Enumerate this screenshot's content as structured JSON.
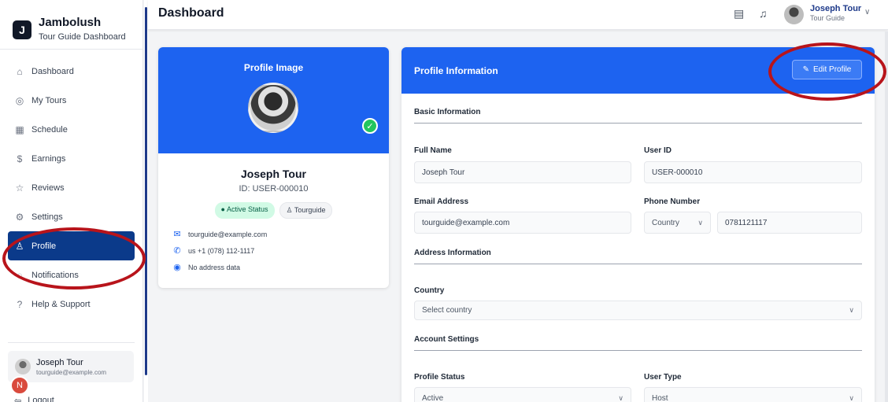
{
  "brand": {
    "name": "Jambolush",
    "subtitle": "Tour Guide Dashboard",
    "logo_glyph": "J"
  },
  "sidebar": {
    "items": [
      {
        "label": "Dashboard",
        "icon": "dashboard-icon",
        "glyph": "⌂"
      },
      {
        "label": "My Tours",
        "icon": "compass-icon",
        "glyph": "◎"
      },
      {
        "label": "Schedule",
        "icon": "calendar-icon",
        "glyph": "▦"
      },
      {
        "label": "Earnings",
        "icon": "earnings-icon",
        "glyph": "$"
      },
      {
        "label": "Reviews",
        "icon": "star-icon",
        "glyph": "☆"
      },
      {
        "label": "Settings",
        "icon": "gear-icon",
        "glyph": "⚙"
      },
      {
        "label": "Profile",
        "icon": "user-icon",
        "glyph": "♙",
        "active": true
      },
      {
        "label": "Notifications",
        "icon": "bell-icon",
        "glyph": "◌"
      },
      {
        "label": "Help & Support",
        "icon": "help-icon",
        "glyph": "?"
      }
    ],
    "user": {
      "name": "Joseph Tour",
      "email": "tourguide@example.com"
    },
    "badge_letter": "N",
    "logout_label": "Logout"
  },
  "header": {
    "title": "Dashboard",
    "user_name": "Joseph Tour",
    "user_role": "Tour Guide"
  },
  "profile_card": {
    "title": "Profile Image",
    "name": "Joseph Tour",
    "id_text": "ID: USER-000010",
    "status_badge": "● Active Status",
    "role_badge": "♙ Tourguide",
    "email": "tourguide@example.com",
    "phone": "us +1 (078) 112-1117",
    "address": "No address data"
  },
  "info_card": {
    "title": "Profile Information",
    "edit_label": "Edit Profile",
    "basic_title": "Basic Information",
    "full_name_label": "Full Name",
    "full_name_value": "Joseph Tour",
    "user_id_label": "User ID",
    "user_id_value": "USER-000010",
    "email_label": "Email Address",
    "email_value": "tourguide@example.com",
    "phone_label": "Phone Number",
    "country_code_value": "Country",
    "phone_value": "0781121117",
    "address_title": "Address Information",
    "country_label": "Country",
    "country_placeholder": "Select country",
    "account_title": "Account Settings",
    "profile_status_label": "Profile Status",
    "profile_status_value": "Active",
    "user_type_label": "User Type",
    "user_type_value": "Host"
  },
  "colors": {
    "primary_blue": "#1d63f0",
    "nav_active": "#0b3a8a",
    "annotation_red": "#b8141b",
    "success_green": "#22c55e"
  }
}
